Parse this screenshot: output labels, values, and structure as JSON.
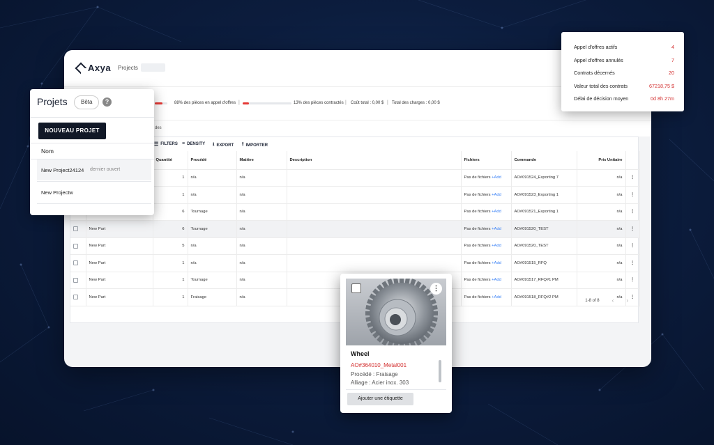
{
  "app": {
    "logo_text": "Axya",
    "nav_projects": "Projects",
    "stats": {
      "rfq_label": "88% des pièces en appel d'offres",
      "rfq_progress": 0.14,
      "contracted_label": "13% des pièces contractés",
      "contracted_progress": 0.13,
      "cout_total": "Coût total : 0,00 $",
      "total_charges": "Total des charges : 0,00 $"
    },
    "tab_fragment": "des",
    "toolbar": {
      "filters": "FILTERS",
      "density": "DENSITY",
      "export": "EXPORT",
      "importer": "IMPORTER"
    },
    "columns": [
      "",
      "",
      "Quantité",
      "Procédé",
      "Matière",
      "Description",
      "Fichiers",
      "Commande",
      "Prix Unitaire",
      ""
    ],
    "rows": [
      {
        "name": "",
        "qty": "1",
        "procede": "n/a",
        "matiere": "n/a",
        "fichiers": "Pas de fichiers",
        "add": "+Add",
        "commande": "AO#091524_Exporting 7",
        "prix": "n/a"
      },
      {
        "name": "",
        "qty": "1",
        "procede": "n/a",
        "matiere": "n/a",
        "fichiers": "Pas de fichiers",
        "add": "+Add",
        "commande": "AO#091523_Exporting 1",
        "prix": "n/a"
      },
      {
        "name": "",
        "qty": "6",
        "procede": "Tournage",
        "matiere": "n/a",
        "fichiers": "Pas de fichiers",
        "add": "+Add",
        "commande": "AO#091521_Exporting 1",
        "prix": "n/a"
      },
      {
        "name": "New Part",
        "qty": "6",
        "procede": "Tournage",
        "matiere": "n/a",
        "fichiers": "Pas de fichiers",
        "add": "+Add",
        "commande": "AO#091520_TEST",
        "prix": "n/a"
      },
      {
        "name": "New Part",
        "qty": "5",
        "procede": "n/a",
        "matiere": "n/a",
        "fichiers": "Pas de fichiers",
        "add": "+Add",
        "commande": "AO#091520_TEST",
        "prix": "n/a"
      },
      {
        "name": "New Part",
        "qty": "1",
        "procede": "n/a",
        "matiere": "n/a",
        "fichiers": "Pas de fichiers",
        "add": "+Add",
        "commande": "AO#091515_RFQ",
        "prix": "n/a"
      },
      {
        "name": "New Part",
        "qty": "1",
        "procede": "Tournage",
        "matiere": "n/a",
        "fichiers": "Pas de fichiers",
        "add": "+Add",
        "commande": "AO#091517_RFQ#1 PM",
        "prix": "n/a"
      },
      {
        "name": "New Part",
        "qty": "1",
        "procede": "Fraisage",
        "matiere": "n/a",
        "fichiers": "Pas de fichiers",
        "add": "+Add",
        "commande": "AO#091518_RFQ#2 PM",
        "prix": "n/a"
      }
    ],
    "pagination": "1-8 of 8"
  },
  "projects_panel": {
    "title": "Projets",
    "beta": "Bêta",
    "new_button": "NOUVEAU PROJET",
    "column": "Nom",
    "items": [
      {
        "name": "New Project24124",
        "sub": "dernier ouvert"
      },
      {
        "name": "New Projectw",
        "sub": ""
      }
    ]
  },
  "stats_panel": {
    "rows": [
      {
        "label": "Appel d'offres actifs",
        "value": "4"
      },
      {
        "label": "Appel d'offres annulés",
        "value": "7"
      },
      {
        "label": "Contrats décernés",
        "value": "20"
      },
      {
        "label": "Valeur total des contrats",
        "value": "67218,75 $"
      },
      {
        "label": "Délai de décision moyen",
        "value": "0d 8h 27m"
      }
    ]
  },
  "part_card": {
    "title": "Wheel",
    "ref": "AO#364010_Metal001",
    "procede": "Procédé : Fraisage",
    "alliage": "Alliage : Acier inox. 303",
    "button": "Ajouter une étiquette"
  },
  "colors": {
    "accent_red": "#d32f2f",
    "link_blue": "#3b82f6",
    "dark_button": "#111827",
    "background_navy": "#0c1d3e"
  }
}
